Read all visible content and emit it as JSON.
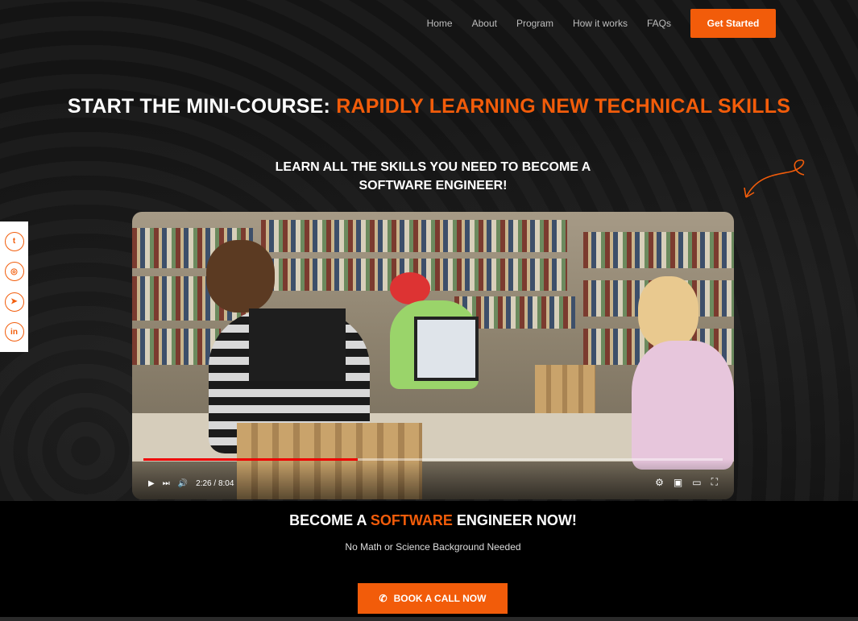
{
  "nav": {
    "items": [
      "Home",
      "About",
      "Program",
      "How it works",
      "FAQs"
    ],
    "cta": "Get Started"
  },
  "hero": {
    "title_part1": "START THE MINI-COURSE: ",
    "title_accent": "RAPIDLY LEARNING NEW TECHNICAL SKILLS",
    "subtitle_line1": "LEARN ALL THE SKILLS YOU NEED TO BECOME A",
    "subtitle_line2": "SOFTWARE ENGINEER!"
  },
  "social": {
    "icons": [
      "twitter-icon",
      "instagram-icon",
      "telegram-icon",
      "linkedin-icon"
    ],
    "glyphs": [
      "t",
      "◎",
      "➤",
      "in"
    ]
  },
  "video": {
    "time": "2:26 / 8:04",
    "progress": 0.37
  },
  "cta_section": {
    "title_part1": "BECOME A ",
    "title_accent": "SOFTWARE",
    "title_part2": " ENGINEER NOW!",
    "subtitle": "No Math or Science Background Needed",
    "button": "BOOK A CALL NOW"
  },
  "colors": {
    "accent": "#f25c0a",
    "background": "#0d0d0d"
  }
}
